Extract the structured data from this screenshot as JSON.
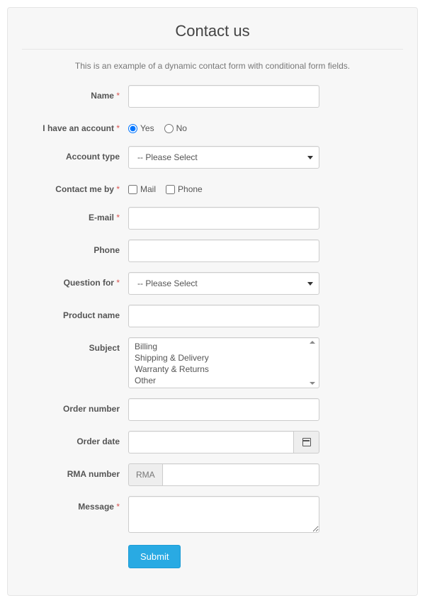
{
  "header": {
    "title": "Contact us"
  },
  "intro": "This is an example of a dynamic contact form with conditional form fields.",
  "fields": {
    "name": {
      "label": "Name",
      "required": true,
      "value": ""
    },
    "have_account": {
      "label": "I have an account",
      "required": true,
      "options": {
        "yes": "Yes",
        "no": "No"
      },
      "selected": "yes"
    },
    "account_type": {
      "label": "Account type",
      "required": false,
      "placeholder": "-- Please Select"
    },
    "contact_by": {
      "label": "Contact me by",
      "required": true,
      "options": {
        "mail": "Mail",
        "phone": "Phone"
      }
    },
    "email": {
      "label": "E-mail",
      "required": true,
      "value": ""
    },
    "phone": {
      "label": "Phone",
      "required": false,
      "value": ""
    },
    "question_for": {
      "label": "Question for",
      "required": true,
      "placeholder": "-- Please Select"
    },
    "product_name": {
      "label": "Product name",
      "required": false,
      "value": ""
    },
    "subject": {
      "label": "Subject",
      "required": false,
      "options": [
        "Billing",
        "Shipping & Delivery",
        "Warranty & Returns",
        "Other"
      ]
    },
    "order_number": {
      "label": "Order number",
      "required": false,
      "value": ""
    },
    "order_date": {
      "label": "Order date",
      "required": false,
      "value": ""
    },
    "rma_number": {
      "label": "RMA number",
      "required": false,
      "prefix": "RMA",
      "value": ""
    },
    "message": {
      "label": "Message",
      "required": true,
      "value": ""
    }
  },
  "buttons": {
    "submit": "Submit"
  },
  "icons": {
    "calendar": "calendar-icon"
  },
  "colors": {
    "primary": "#29aae3",
    "required": "#d9534f"
  }
}
